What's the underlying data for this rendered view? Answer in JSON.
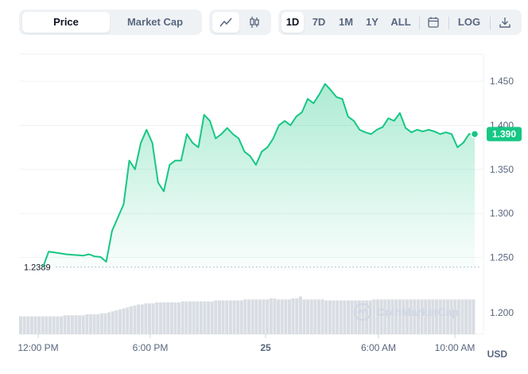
{
  "toolbar": {
    "metric_tabs": [
      {
        "label": "Price",
        "active": true
      },
      {
        "label": "Market Cap",
        "active": false
      }
    ],
    "chart_type_icons": [
      {
        "icon": "line-chart-icon",
        "active": true
      },
      {
        "icon": "candlestick-icon",
        "active": false
      }
    ],
    "ranges": [
      {
        "label": "1D",
        "active": true
      },
      {
        "label": "7D",
        "active": false
      },
      {
        "label": "1M",
        "active": false
      },
      {
        "label": "1Y",
        "active": false
      },
      {
        "label": "ALL",
        "active": false
      }
    ],
    "calendar_icon": "calendar-icon",
    "log_label": "LOG",
    "download_icon": "download-icon"
  },
  "currency": "USD",
  "watermark": "CoinMarketCap",
  "colors": {
    "line": "#16c784",
    "area_top": "#16c784",
    "volume": "#d9dde3",
    "grid": "#eff2f5",
    "axis_text": "#58667e"
  },
  "chart_data": {
    "type": "line",
    "x_label_ticks": [
      "12:00 PM",
      "6:00 PM",
      "25",
      "6:00 AM",
      "10:00 AM"
    ],
    "y_ticks": [
      1.25,
      1.3,
      1.35,
      1.4,
      1.45
    ],
    "y_tick_labels": [
      "1.250",
      "1.300",
      "1.350",
      "1.400",
      "1.450"
    ],
    "ylim": [
      1.235,
      1.47
    ],
    "reference_line": {
      "value": 1.2389,
      "label": "1.2389"
    },
    "current_price": {
      "value": 1.39,
      "label": "1.390"
    },
    "series": [
      {
        "values": [
          1.2389,
          1.2565,
          1.2555,
          1.2545,
          1.2535,
          1.253,
          1.2525,
          1.252,
          1.2535,
          1.251,
          1.2505,
          1.245,
          1.28,
          1.295,
          1.31,
          1.36,
          1.35,
          1.38,
          1.395,
          1.38,
          1.335,
          1.325,
          1.355,
          1.36,
          1.36,
          1.39,
          1.38,
          1.375,
          1.412,
          1.405,
          1.385,
          1.39,
          1.397,
          1.39,
          1.385,
          1.37,
          1.365,
          1.355,
          1.37,
          1.375,
          1.385,
          1.4,
          1.405,
          1.4,
          1.41,
          1.415,
          1.43,
          1.425,
          1.435,
          1.447,
          1.44,
          1.432,
          1.43,
          1.41,
          1.405,
          1.395,
          1.392,
          1.39,
          1.395,
          1.398,
          1.408,
          1.405,
          1.414,
          1.397,
          1.392,
          1.395,
          1.393,
          1.395,
          1.393,
          1.39,
          1.392,
          1.39,
          1.375,
          1.38,
          1.39,
          1.39
        ]
      }
    ],
    "volume": {
      "values": [
        18,
        18,
        18,
        18,
        18,
        18,
        18,
        18,
        18,
        18,
        18,
        18,
        19,
        19,
        19,
        19,
        19,
        19,
        20,
        20,
        20,
        20,
        21,
        21,
        22,
        23,
        24,
        25,
        26,
        27,
        28,
        29,
        30,
        30,
        31,
        31,
        31,
        32,
        32,
        32,
        32,
        32,
        32,
        32,
        33,
        33,
        33,
        33,
        33,
        33,
        33,
        33,
        33,
        34,
        34,
        34,
        34,
        34,
        34,
        34,
        34,
        35,
        35,
        35,
        35,
        35,
        35,
        35,
        36,
        36,
        35,
        35,
        35,
        35,
        36,
        36,
        38,
        35,
        35,
        35,
        35,
        35,
        35,
        34,
        34,
        34,
        34,
        34,
        34,
        34,
        34,
        34,
        34,
        34,
        34,
        34,
        35,
        35,
        35,
        35,
        35,
        35,
        35,
        35,
        35,
        35,
        35,
        35,
        35,
        35,
        35,
        35,
        35,
        35,
        35,
        35,
        35,
        35,
        35,
        35,
        35,
        35,
        35,
        35
      ]
    }
  }
}
